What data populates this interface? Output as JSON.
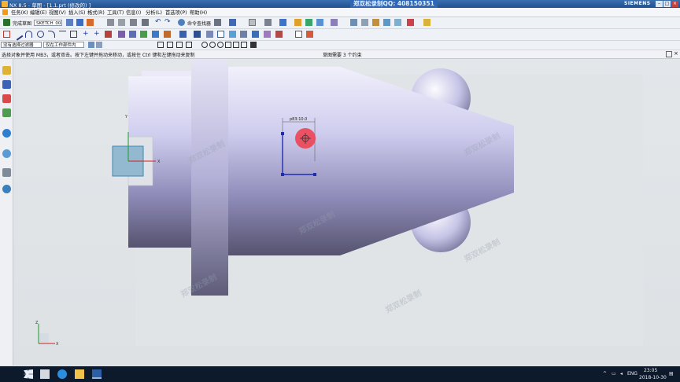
{
  "window": {
    "title": "NX 8.5 - 草图 - [1.1.prt  (修改的)  ]",
    "qq_banner": "郑双松录制QQ: 408150351",
    "brand": "SIEMENS"
  },
  "menu": [
    "任务(K)",
    "编辑(E)",
    "视图(V)",
    "插入(S)",
    "格式(R)",
    "工具(T)",
    "信息(I)",
    "分析(L)",
    "首选项(P)",
    "帮助(H)"
  ],
  "toolbar": {
    "finish_sketch_label": "完成草图",
    "sketch_name": "SKETCH_004",
    "command_finder_label": "命令查找器"
  },
  "filters": {
    "selection_filter": "没有选择过滤器",
    "assembly_scope": "仅在工作部件内"
  },
  "status": {
    "prompt": "选择对象并使用 MB3，或者双击。按下左键并拖动来移动，或按住 Ctrl 键和左键拖动来复制",
    "sketch_status": "草图需要 3 个约束"
  },
  "canvas": {
    "dimension_label": "p83:10.0",
    "axis_x": "X",
    "axis_y": "Y",
    "triad_z": "Z",
    "watermark": "郑双松录制"
  },
  "taskbar": {
    "language": "ENG",
    "time": "23:05",
    "date": "2018-10-30"
  },
  "colors": {
    "titlebar": "#1f4f8f",
    "part_body": "#a9a6d6",
    "sketch_line": "#1e2db0",
    "click_marker": "#f03c4b"
  }
}
